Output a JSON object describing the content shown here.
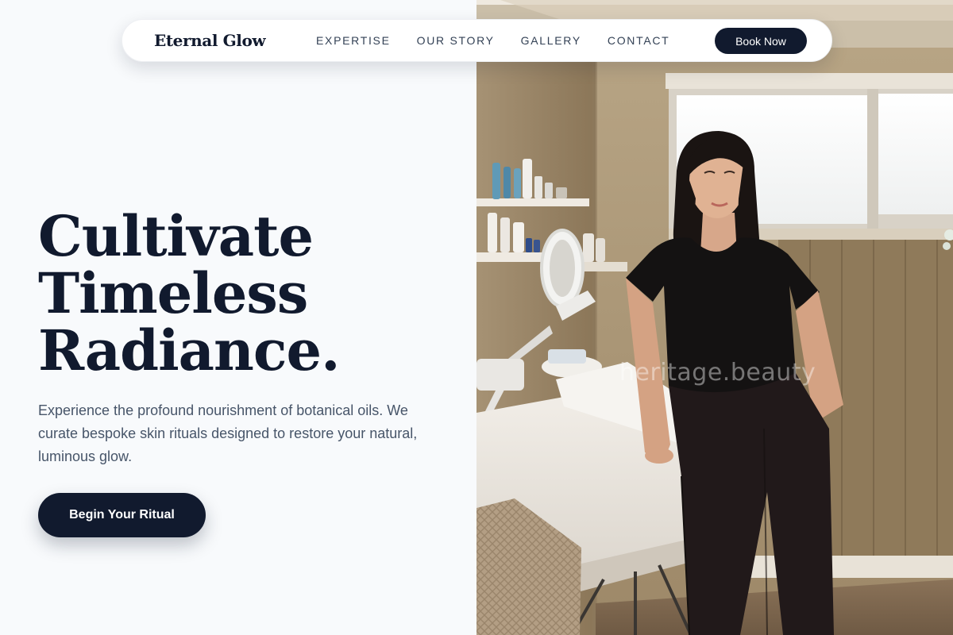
{
  "nav": {
    "brand": "Eternal Glow",
    "links": [
      "EXPERTISE",
      "OUR STORY",
      "GALLERY",
      "CONTACT"
    ],
    "cta_label": "Book Now"
  },
  "hero": {
    "title_lines": [
      "Cultivate",
      "Timeless",
      "Radiance."
    ],
    "description": "Experience the profound nourishment of botanical oils. We curate bespoke skin rituals designed to restore your natural, luminous glow.",
    "cta_label": "Begin Your Ritual"
  },
  "photo": {
    "watermark": "heritage.beauty",
    "subject": "esthetician-in-treatment-room"
  },
  "colors": {
    "primary": "#111a2e",
    "background": "#f8fafc",
    "body_text": "#475569",
    "nav_text": "#334155"
  }
}
